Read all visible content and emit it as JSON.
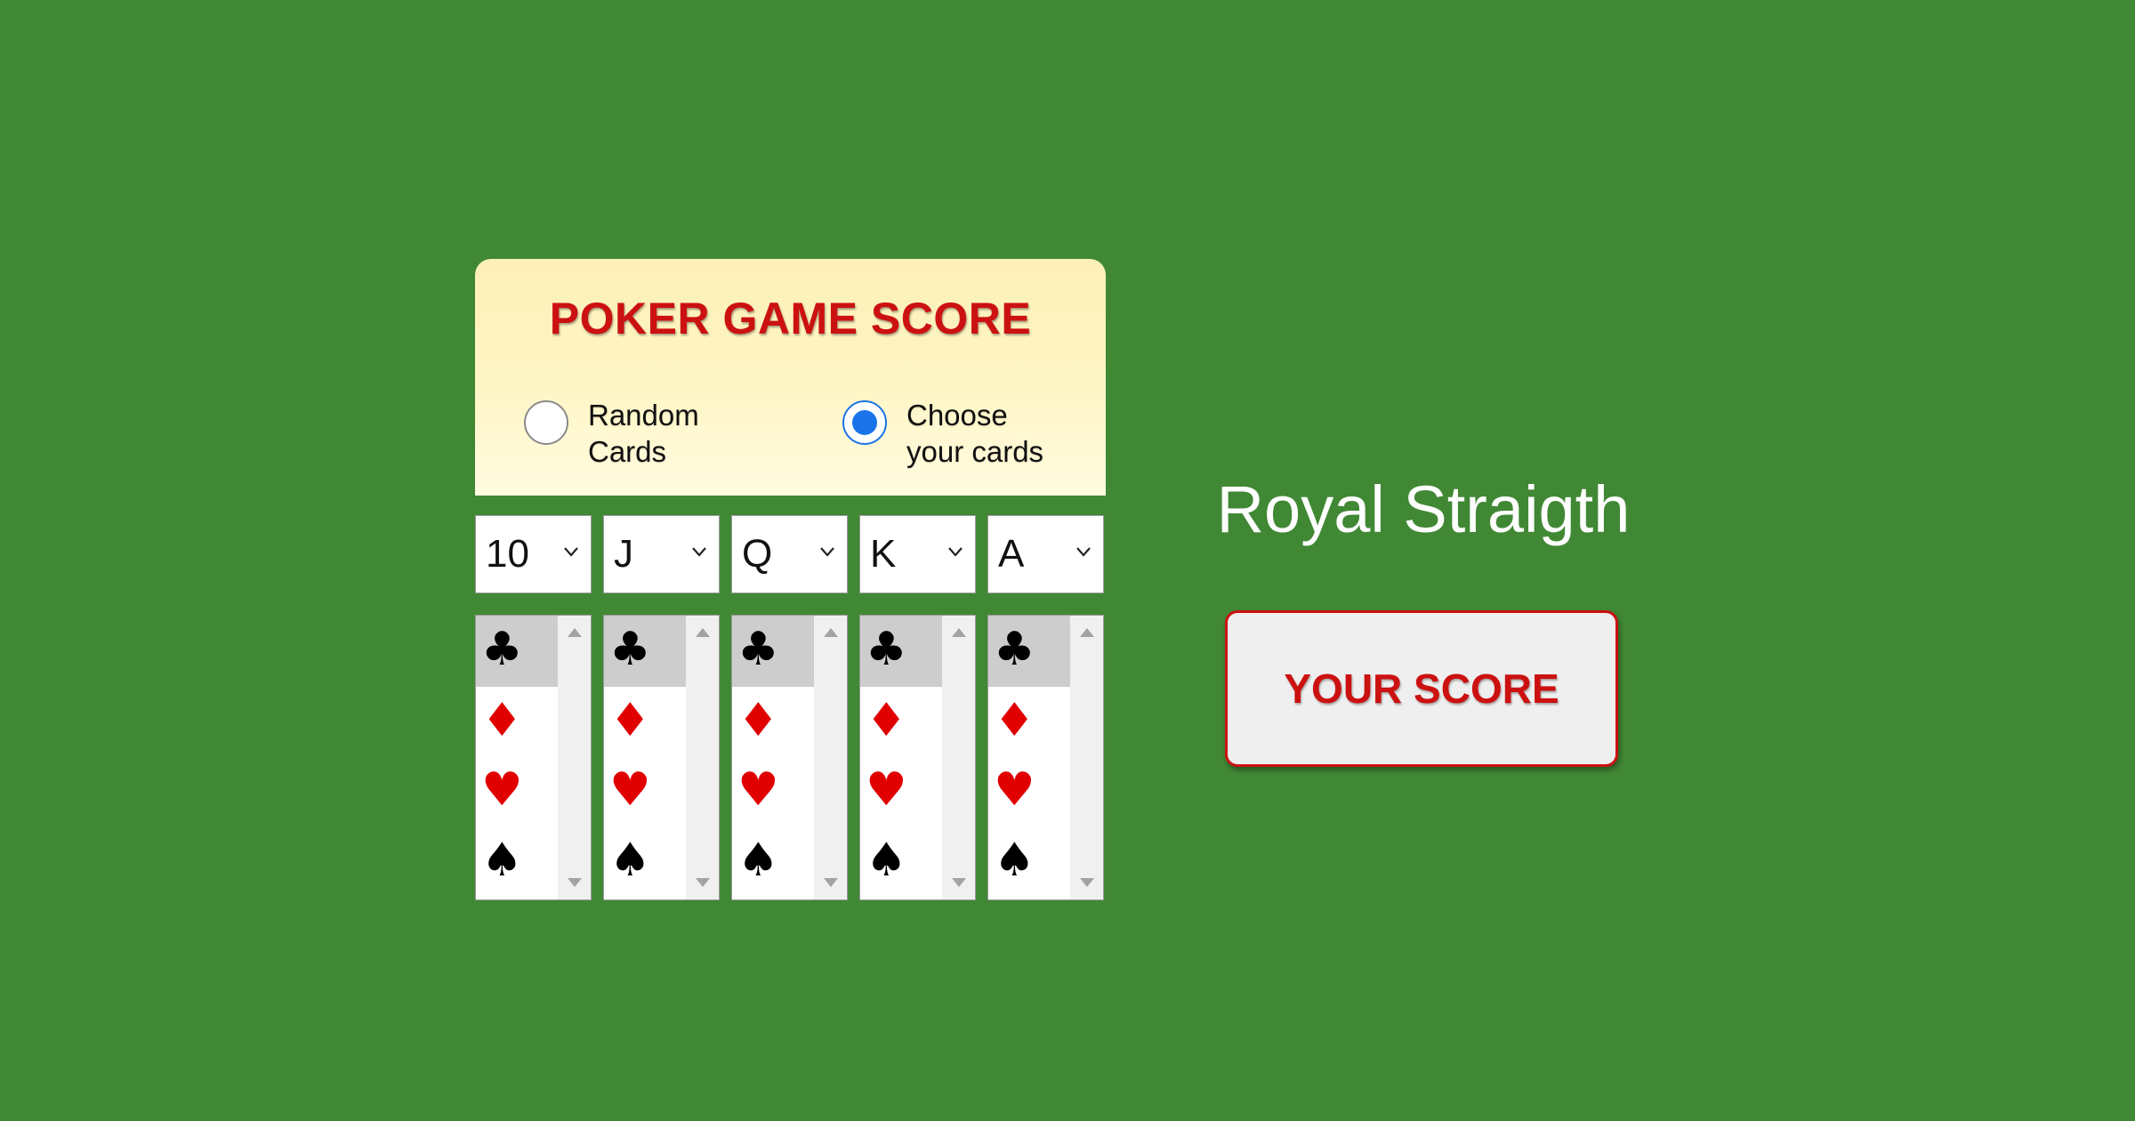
{
  "panel": {
    "title": "POKER GAME SCORE",
    "mode_options": [
      {
        "label": "Random\nCards",
        "checked": false
      },
      {
        "label": "Choose\nyour cards",
        "checked": true
      }
    ]
  },
  "cards": [
    {
      "rank": "10",
      "selected_suit": "clubs"
    },
    {
      "rank": "J",
      "selected_suit": "clubs"
    },
    {
      "rank": "Q",
      "selected_suit": "clubs"
    },
    {
      "rank": "K",
      "selected_suit": "clubs"
    },
    {
      "rank": "A",
      "selected_suit": "clubs"
    }
  ],
  "suits": [
    {
      "name": "clubs",
      "glyph": "♣",
      "color": "#000000"
    },
    {
      "name": "diamonds",
      "glyph": "♦",
      "color": "#e00000"
    },
    {
      "name": "hearts",
      "glyph": "♥",
      "color": "#e00000"
    },
    {
      "name": "spades",
      "glyph": "♠",
      "color": "#000000"
    }
  ],
  "result": {
    "hand_name": "Royal Straigth",
    "button_label": "YOUR SCORE"
  },
  "colors": {
    "background": "#418835",
    "accent_red": "#cc1111",
    "radio_blue": "#1a73e8"
  }
}
